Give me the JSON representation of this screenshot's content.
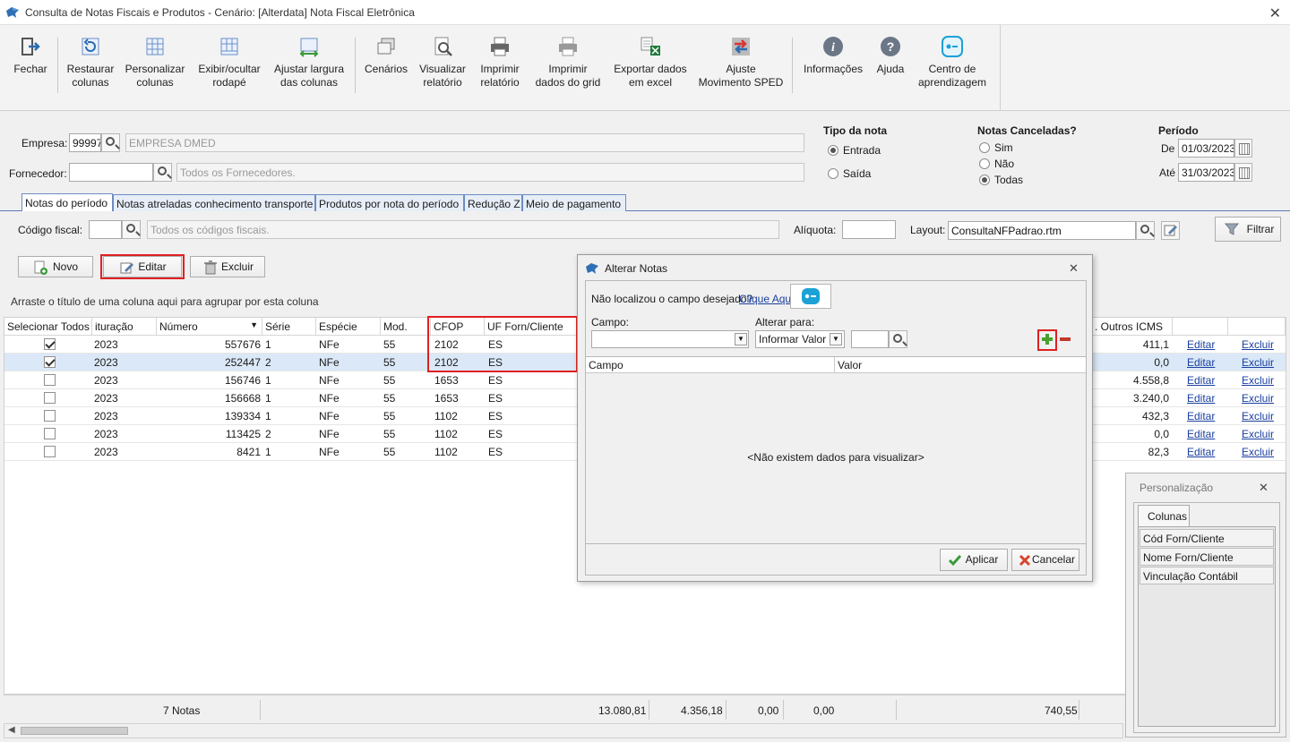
{
  "window": {
    "title": "Consulta de Notas Fiscais e Produtos - Cenário: [Alterdata] Nota Fiscal Eletrônica",
    "close": "✕"
  },
  "toolbar": [
    {
      "line1": "Fechar",
      "line2": ""
    },
    {
      "line1": "Restaurar",
      "line2": "colunas"
    },
    {
      "line1": "Personalizar",
      "line2": "colunas"
    },
    {
      "line1": "Exibir/ocultar",
      "line2": "rodapé"
    },
    {
      "line1": "Ajustar largura",
      "line2": "das colunas"
    },
    {
      "line1": "Cenários",
      "line2": ""
    },
    {
      "line1": "Visualizar",
      "line2": "relatório"
    },
    {
      "line1": "Imprimir",
      "line2": "relatório"
    },
    {
      "line1": "Imprimir",
      "line2": "dados do grid"
    },
    {
      "line1": "Exportar dados",
      "line2": "em excel"
    },
    {
      "line1": "Ajuste",
      "line2": "Movimento SPED"
    },
    {
      "line1": "Informações",
      "line2": ""
    },
    {
      "line1": "Ajuda",
      "line2": ""
    },
    {
      "line1": "Centro de",
      "line2": "aprendizagem"
    }
  ],
  "filters": {
    "empresa_label": "Empresa:",
    "empresa_code": "99997",
    "empresa_name": "EMPRESA DMED",
    "fornecedor_label": "Fornecedor:",
    "fornecedor_code": "",
    "fornecedor_placeholder": "Todos os Fornecedores.",
    "tipo_nota_title": "Tipo da nota",
    "tipo_entrada": "Entrada",
    "tipo_saida": "Saída",
    "canceladas_title": "Notas Canceladas?",
    "canc_sim": "Sim",
    "canc_nao": "Não",
    "canc_todas": "Todas",
    "periodo_title": "Período",
    "de_label": "De",
    "de_value": "01/03/2023",
    "ate_label": "Até",
    "ate_value": "31/03/2023"
  },
  "tabs": [
    "Notas do período",
    "Notas atreladas conhecimento transporte",
    "Produtos por nota do período",
    "Redução Z",
    "Meio de pagamento"
  ],
  "panel": {
    "codigo_fiscal_label": "Código fiscal:",
    "codigo_fiscal_value": "",
    "codigo_fiscal_placeholder": "Todos os códigos fiscais.",
    "aliquota_label": "Alíquota:",
    "aliquota_value": "",
    "layout_label": "Layout:",
    "layout_value": "ConsultaNFPadrao.rtm",
    "filtrar": "Filtrar",
    "novo": "Novo",
    "editar": "Editar",
    "excluir": "Excluir",
    "group_hint": "Arraste o título de uma coluna aqui para agrupar por esta coluna"
  },
  "grid": {
    "headers": {
      "sel": "Selecionar Todos",
      "escr": "ituração",
      "numero": "Número",
      "serie": "Série",
      "especie": "Espécie",
      "mod": "Mod.",
      "cfop": "CFOP",
      "uf": "UF Forn/Cliente",
      "outros": ". Outros ICMS"
    },
    "rows": [
      {
        "checked": true,
        "escr": "2023",
        "numero": "557676",
        "serie": "1",
        "especie": "NFe",
        "mod": "55",
        "cfop": "2102",
        "uf": "ES",
        "outros": "411,1",
        "editar": "Editar",
        "excluir": "Excluir"
      },
      {
        "checked": true,
        "escr": "2023",
        "numero": "252447",
        "serie": "2",
        "especie": "NFe",
        "mod": "55",
        "cfop": "2102",
        "uf": "ES",
        "outros": "0,0",
        "editar": "Editar",
        "excluir": "Excluir"
      },
      {
        "checked": false,
        "escr": "2023",
        "numero": "156746",
        "serie": "1",
        "especie": "NFe",
        "mod": "55",
        "cfop": "1653",
        "uf": "ES",
        "outros": "4.558,8",
        "editar": "Editar",
        "excluir": "Excluir"
      },
      {
        "checked": false,
        "escr": "2023",
        "numero": "156668",
        "serie": "1",
        "especie": "NFe",
        "mod": "55",
        "cfop": "1653",
        "uf": "ES",
        "outros": "3.240,0",
        "editar": "Editar",
        "excluir": "Excluir"
      },
      {
        "checked": false,
        "escr": "2023",
        "numero": "139334",
        "serie": "1",
        "especie": "NFe",
        "mod": "55",
        "cfop": "1102",
        "uf": "ES",
        "outros": "432,3",
        "editar": "Editar",
        "excluir": "Excluir"
      },
      {
        "checked": false,
        "escr": "2023",
        "numero": "113425",
        "serie": "2",
        "especie": "NFe",
        "mod": "55",
        "cfop": "1102",
        "uf": "ES",
        "outros": "0,0",
        "editar": "Editar",
        "excluir": "Excluir"
      },
      {
        "checked": false,
        "escr": "2023",
        "numero": "8421",
        "serie": "1",
        "especie": "NFe",
        "mod": "55",
        "cfop": "1102",
        "uf": "ES",
        "outros": "82,3",
        "editar": "Editar",
        "excluir": "Excluir"
      }
    ]
  },
  "footer": {
    "count": "7 Notas",
    "v1": "13.080,81",
    "v2": "4.356,18",
    "v3": "0,00",
    "v4": "0,00",
    "v5": "740,55"
  },
  "dialog": {
    "title": "Alterar Notas",
    "not_found": "Não localizou o campo desejado?",
    "click_here": "Clique Aqui",
    "campo_label": "Campo:",
    "campo_value": "",
    "alterar_label": "Alterar para:",
    "alterar_value": "Informar Valor",
    "valor_input": "",
    "col_campo": "Campo",
    "col_valor": "Valor",
    "empty": "<Não existem dados para visualizar>",
    "aplicar": "Aplicar",
    "cancelar": "Cancelar"
  },
  "personalizacao": {
    "title": "Personalização",
    "tab": "Colunas",
    "items": [
      "Cód Forn/Cliente",
      "Nome Forn/Cliente",
      "Vinculação Contábil"
    ]
  }
}
